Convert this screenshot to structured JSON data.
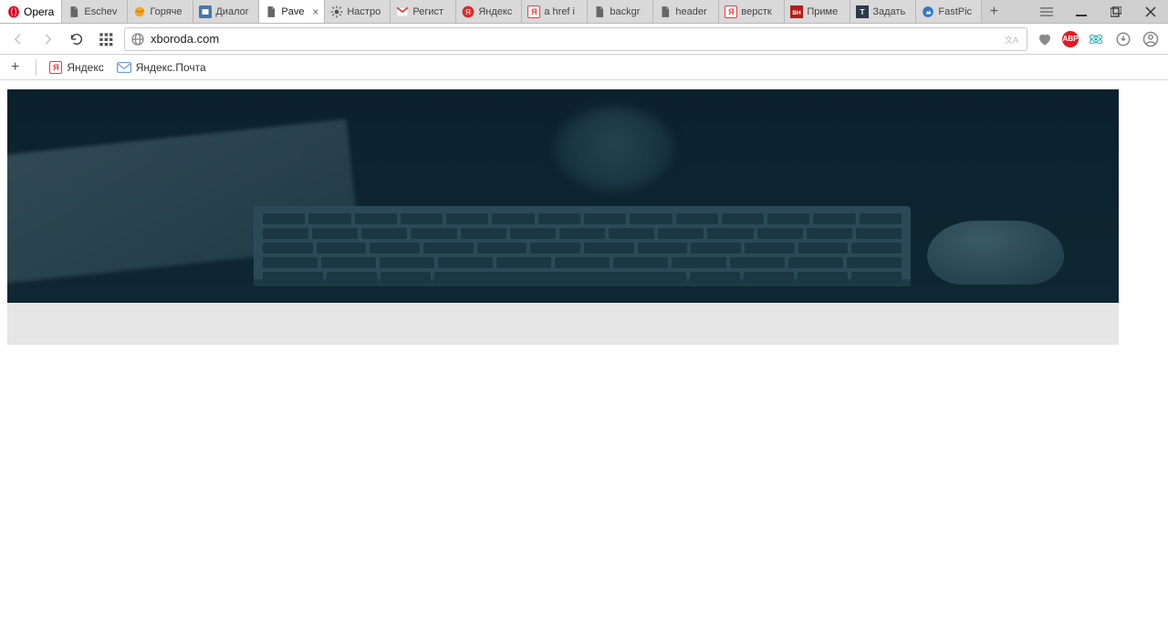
{
  "window": {
    "app_name": "Opera"
  },
  "tabs": [
    {
      "label": "Eschev",
      "icon": "doc"
    },
    {
      "label": "Горяче",
      "icon": "ball"
    },
    {
      "label": "Диалог",
      "icon": "vk"
    },
    {
      "label": "Pave",
      "icon": "doc",
      "active": true
    },
    {
      "label": "Настро",
      "icon": "gear"
    },
    {
      "label": "Регист",
      "icon": "gmail"
    },
    {
      "label": "Яндекс",
      "icon": "ybadge"
    },
    {
      "label": "a href i",
      "icon": "y"
    },
    {
      "label": "backgr",
      "icon": "doc"
    },
    {
      "label": "header",
      "icon": "doc"
    },
    {
      "label": "верстк",
      "icon": "y"
    },
    {
      "label": "Приме",
      "icon": "bh"
    },
    {
      "label": "Задать",
      "icon": "t"
    },
    {
      "label": "FastPic",
      "icon": "fp"
    }
  ],
  "address": {
    "url": "xboroda.com"
  },
  "bookmarks": [
    {
      "label": "Яндекс",
      "icon": "y"
    },
    {
      "label": "Яндекс.Почта",
      "icon": "ymail"
    }
  ]
}
